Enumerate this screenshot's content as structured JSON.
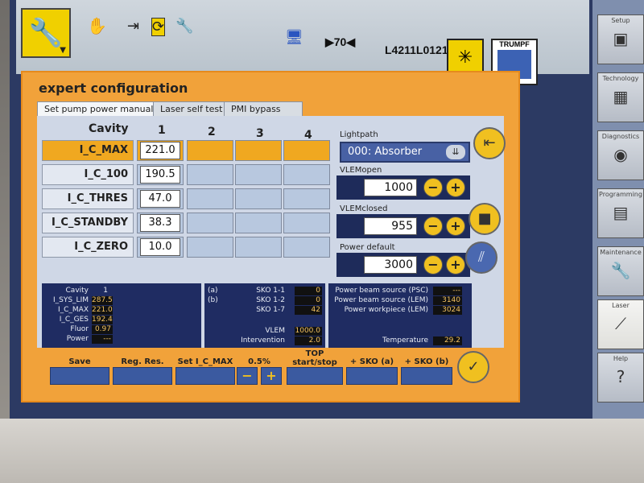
{
  "topbar": {
    "hand_icon": "hand-icon",
    "counter": "▶70◀",
    "machine_id": "L4211L0121",
    "brand": "TRUMPF"
  },
  "dialog": {
    "title": "expert configuration",
    "tabs": [
      "Set pump power manually",
      "Laser self test",
      "PMI bypass"
    ]
  },
  "grid": {
    "cavity_header": "Cavity",
    "columns": [
      "1",
      "2",
      "3",
      "4"
    ],
    "rows": [
      {
        "label": "I_C_MAX",
        "value": "221.0"
      },
      {
        "label": "I_C_100",
        "value": "190.5"
      },
      {
        "label": "I_C_THRES",
        "value": "47.0"
      },
      {
        "label": "I_C_STANDBY",
        "value": "38.3"
      },
      {
        "label": "I_C_ZERO",
        "value": "10.0"
      }
    ]
  },
  "right_panel": {
    "lightpath_label": "Lightpath",
    "lightpath_value": "000: Absorber",
    "vlemopen_label": "VLEMopen",
    "vlemopen_value": "1000",
    "vlemclosed_label": "VLEMclosed",
    "vlemclosed_value": "955",
    "power_default_label": "Power default",
    "power_default_value": "3000"
  },
  "info_left": {
    "rows": [
      {
        "k": "Cavity",
        "v": "1"
      },
      {
        "k": "I_SYS_LIM",
        "v": "287.5"
      },
      {
        "k": "I_C_MAX",
        "v": "221.0"
      },
      {
        "k": "I_C_GES",
        "v": "192.4"
      },
      {
        "k": "Fluor",
        "v": "0.97"
      },
      {
        "k": "Power",
        "v": "---"
      }
    ]
  },
  "info_mid": {
    "a": "(a)",
    "b": "(b)",
    "rows": [
      {
        "k": "SKO 1-1",
        "v": "0"
      },
      {
        "k": "SKO 1-2",
        "v": "0"
      },
      {
        "k": "SKO 1-7",
        "v": "42"
      }
    ],
    "vlem_label": "VLEM",
    "vlem_value": "1000.0",
    "intervention_label": "Intervention",
    "intervention_value": "2.0"
  },
  "info_right": {
    "rows": [
      {
        "k": "Power beam source (PSC)",
        "v": "---"
      },
      {
        "k": "Power beam source (LEM)",
        "v": "3140"
      },
      {
        "k": "Power workpiece (LEM)",
        "v": "3024"
      }
    ],
    "temp_label": "Temperature",
    "temp_value": "29.2"
  },
  "buttons": {
    "save": "Save",
    "reg_res": "Reg. Res.",
    "set_icmax": "Set I_C_MAX",
    "percent": "0.5%",
    "minus": "−",
    "plus": "+",
    "top": "TOP\nstart/stop",
    "sko_a": "+ SKO (a)",
    "sko_b": "+ SKO (b)"
  },
  "sidebar": {
    "items": [
      {
        "label": "Setup",
        "icon": "setup-icon"
      },
      {
        "label": "Technology",
        "icon": "technology-icon"
      },
      {
        "label": "Diagnostics",
        "icon": "eye-icon"
      },
      {
        "label": "Programming",
        "icon": "programming-icon"
      },
      {
        "label": "Maintenance",
        "icon": "wrench-icon"
      },
      {
        "label": "Laser",
        "icon": "laser-icon"
      },
      {
        "label": "Help",
        "icon": "help-icon"
      }
    ]
  },
  "colors": {
    "accent": "#f0c020",
    "orange": "#f1a23a",
    "panel_blue": "#1f2c62"
  }
}
